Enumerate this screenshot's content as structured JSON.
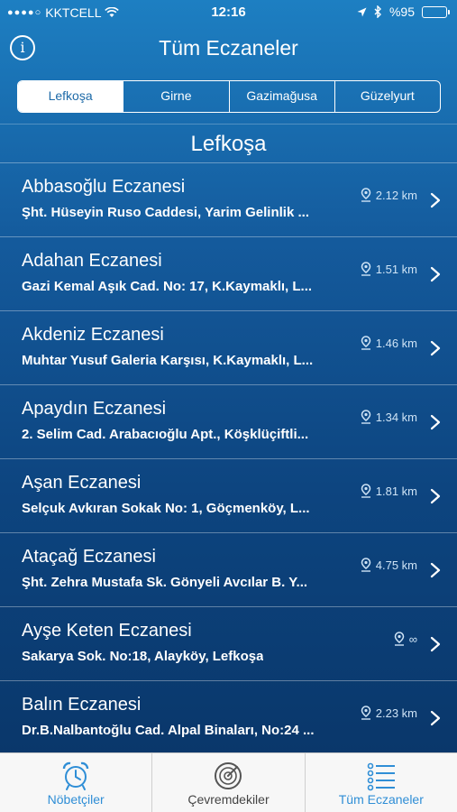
{
  "status_bar": {
    "signal_dots": "●●●●○",
    "carrier": "KKTCELL",
    "time": "12:16",
    "battery_text": "%95",
    "battery_level": 0.95
  },
  "nav": {
    "title": "Tüm Eczaneler"
  },
  "segments": [
    "Lefkoşa",
    "Girne",
    "Gazimağusa",
    "Güzelyurt"
  ],
  "selected_segment": "Lefkoşa",
  "section_title": "Lefkoşa",
  "pharmacies": [
    {
      "name": "Abbasoğlu Eczanesi",
      "address": "Şht. Hüseyin Ruso Caddesi, Yarim Gelinlik ...",
      "distance": "2.12 km"
    },
    {
      "name": "Adahan Eczanesi",
      "address": "Gazi Kemal Aşık Cad. No: 17, K.Kaymaklı, L...",
      "distance": "1.51 km"
    },
    {
      "name": "Akdeniz Eczanesi",
      "address": "Muhtar Yusuf Galeria Karşısı, K.Kaymaklı, L...",
      "distance": "1.46 km"
    },
    {
      "name": "Apaydın Eczanesi",
      "address": "2. Selim Cad. Arabacıoğlu Apt., Köşklüçiftli...",
      "distance": "1.34 km"
    },
    {
      "name": "Aşan Eczanesi",
      "address": "Selçuk Avkıran Sokak No: 1, Göçmenköy, L...",
      "distance": "1.81 km"
    },
    {
      "name": "Ataçağ Eczanesi",
      "address": "Şht. Zehra Mustafa Sk. Gönyeli Avcılar B. Y...",
      "distance": "4.75 km"
    },
    {
      "name": "Ayşe Keten Eczanesi",
      "address": "Sakarya Sok. No:18, Alayköy, Lefkoşa",
      "distance": "∞"
    },
    {
      "name": "Balın Eczanesi",
      "address": "Dr.B.Nalbantoğlu Cad. Alpal Binaları, No:24 ...",
      "distance": "2.23 km"
    }
  ],
  "tabs": [
    {
      "label": "Nöbetçiler",
      "icon": "alarm-clock-icon"
    },
    {
      "label": "Çevremdekiler",
      "icon": "radar-icon"
    },
    {
      "label": "Tüm Eczaneler",
      "icon": "list-icon"
    }
  ],
  "colors": {
    "accent": "#2f8ed6",
    "active_segment_text": "#1d6aa8",
    "battery": "#4cd964"
  }
}
